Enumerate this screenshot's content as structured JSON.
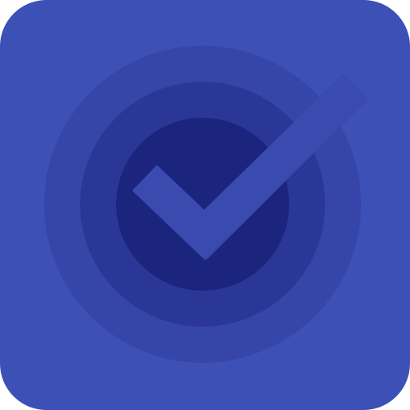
{
  "icon": {
    "name": "checkmark-target-icon",
    "colors": {
      "tile": "#3d50b5",
      "ring_outer": "#3646a8",
      "ring_middle": "#2b3797",
      "ring_inner": "#1c257d",
      "check": "#3a4aaf",
      "check_shadow": "#2f3da0"
    }
  }
}
